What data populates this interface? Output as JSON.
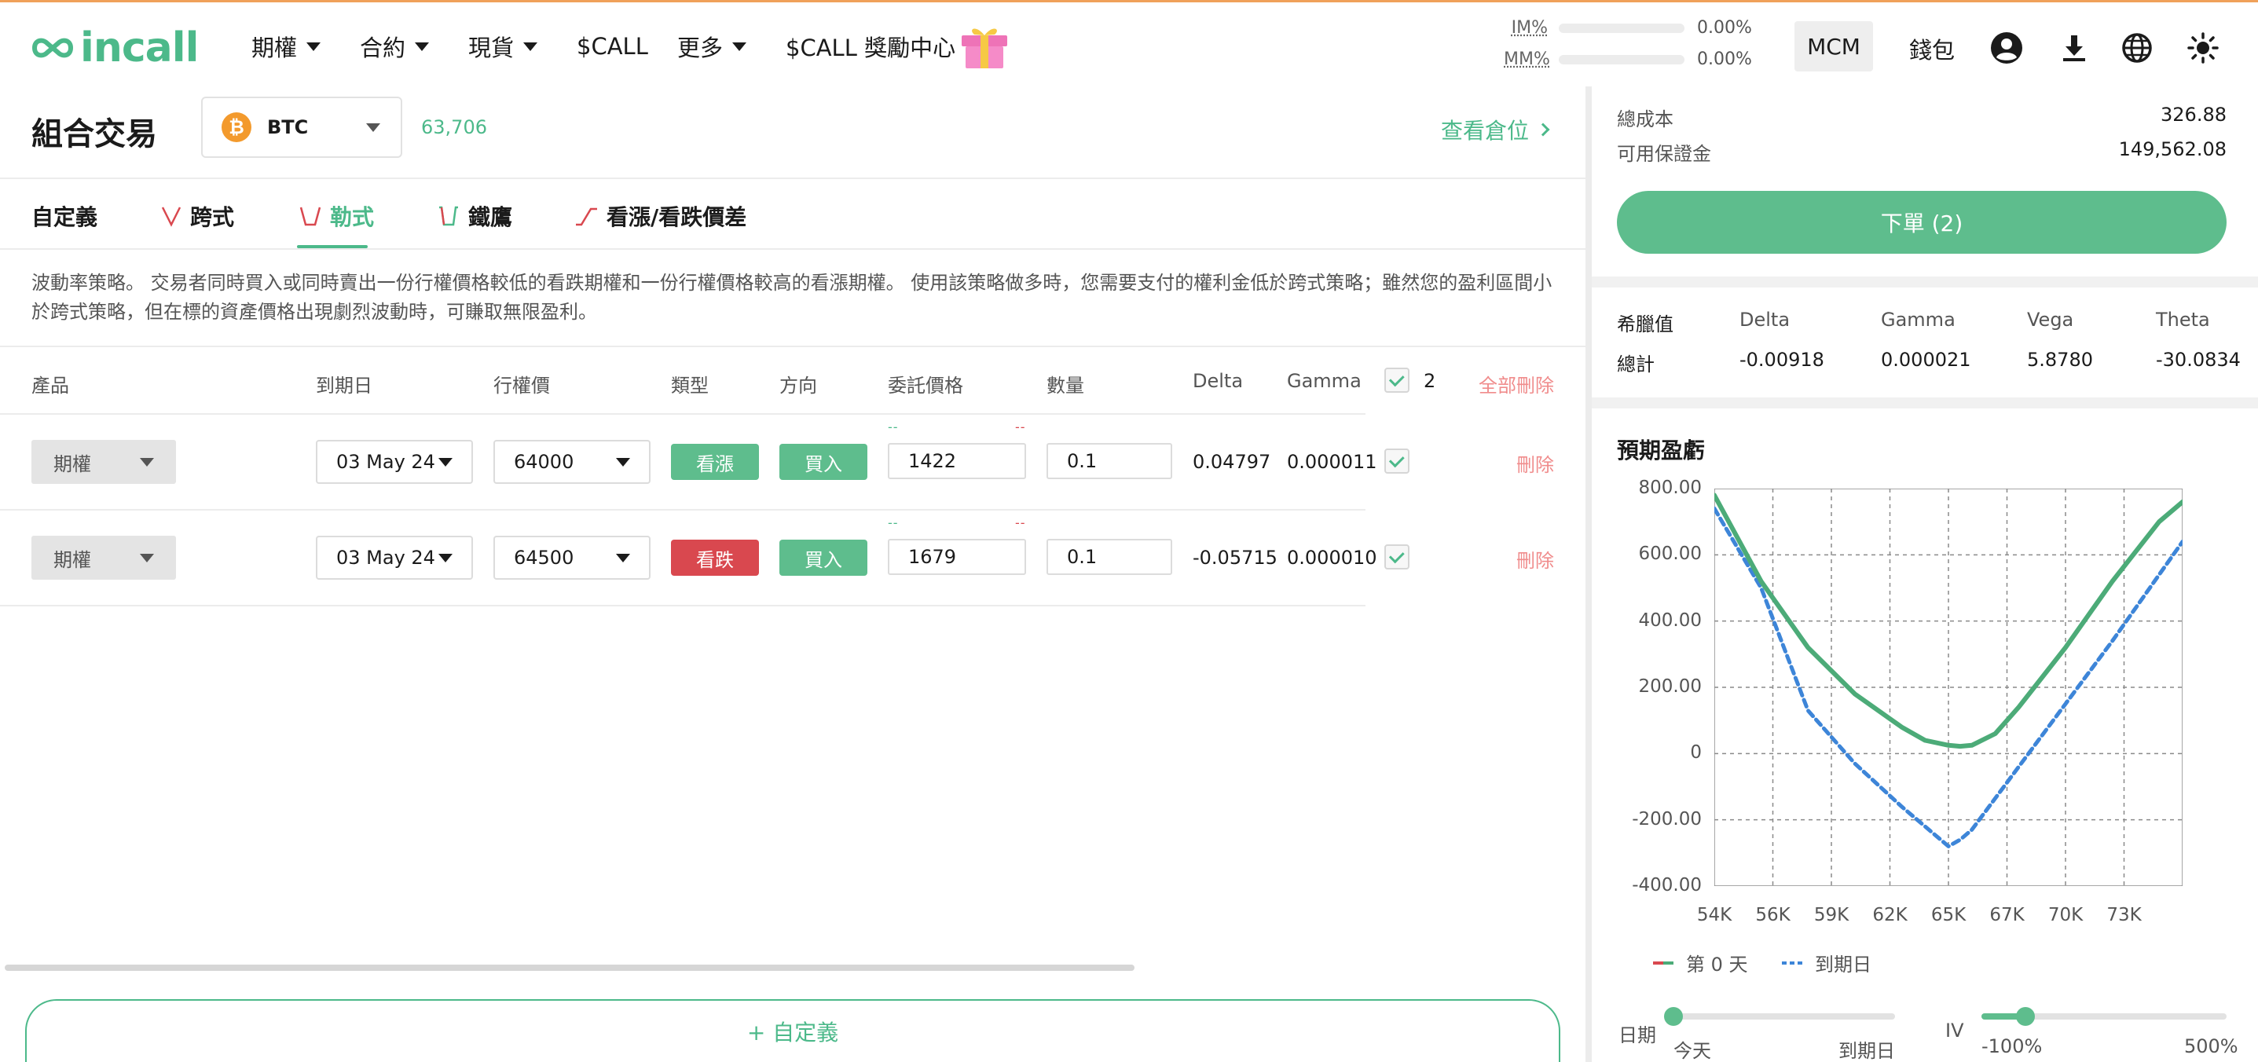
{
  "brand": {
    "name": "incall",
    "accent": "#4cb98a",
    "danger": "#d9484f"
  },
  "nav": {
    "items": [
      {
        "label": "期權",
        "caret": true
      },
      {
        "label": "合約",
        "caret": true
      },
      {
        "label": "現貨",
        "caret": true
      },
      {
        "label": "$CALL",
        "caret": false
      },
      {
        "label": "更多",
        "caret": true
      },
      {
        "label": "$CALL 獎勵中心",
        "caret": false
      }
    ],
    "im_label": "IM%",
    "im_value": "0.00%",
    "mm_label": "MM%",
    "mm_value": "0.00%",
    "mcm_label": "MCM",
    "wallet_label": "錢包",
    "icons": [
      "gift-icon",
      "user-icon",
      "download-icon",
      "globe-icon",
      "sun-icon"
    ]
  },
  "header": {
    "title": "組合交易",
    "asset": "BTC",
    "asset_icon": "bitcoin-icon",
    "price": "63,706",
    "view_positions": "查看倉位"
  },
  "tabs": [
    {
      "label": "自定義",
      "active": false
    },
    {
      "label": "跨式",
      "active": false
    },
    {
      "label": "勒式",
      "active": true
    },
    {
      "label": "鐵鷹",
      "active": false
    },
    {
      "label": "看漲/看跌價差",
      "active": false
    }
  ],
  "description": "波動率策略。 交易者同時買入或同時賣出一份行權價格較低的看跌期權和一份行權價格較高的看漲期權。 使用該策略做多時，您需要支付的權利金低於跨式策略；雖然您的盈利區間小於跨式策略，但在標的資產價格出現劇烈波動時，可賺取無限盈利。",
  "table": {
    "headers": {
      "product": "產品",
      "expiry": "到期日",
      "strike": "行權價",
      "type": "類型",
      "side": "方向",
      "price": "委託價格",
      "qty": "數量",
      "delta": "Delta",
      "gamma": "Gamma"
    },
    "selected_count": "2",
    "delete_all": "全部刪除",
    "rows": [
      {
        "product": "期權",
        "expiry": "03 May 24",
        "strike": "64000",
        "type": "看漲",
        "type_color": "#5ebd8d",
        "side": "買入",
        "bid_hint": "--",
        "ask_hint": "--",
        "price": "1422",
        "qty": "0.1",
        "delta": "0.04797",
        "gamma": "0.000011",
        "delete": "刪除"
      },
      {
        "product": "期權",
        "expiry": "03 May 24",
        "strike": "64500",
        "type": "看跌",
        "type_color": "#d9484f",
        "side": "買入",
        "bid_hint": "--",
        "ask_hint": "--",
        "price": "1679",
        "qty": "0.1",
        "delta": "-0.05715",
        "gamma": "0.000010",
        "delete": "刪除"
      }
    ]
  },
  "add_custom": "+ 自定義",
  "summary": {
    "total_cost_label": "總成本",
    "total_cost": "326.88",
    "margin_label": "可用保證金",
    "margin": "149,562.08",
    "order_button": "下單 (2)"
  },
  "greeks": {
    "header": "希臘值",
    "total_label": "總計",
    "cols": [
      "Delta",
      "Gamma",
      "Vega",
      "Theta"
    ],
    "values": [
      "-0.00918",
      "0.000021",
      "5.8780",
      "-30.0834"
    ]
  },
  "pnl": {
    "title": "預期盈虧",
    "legend": [
      {
        "label": "第 0 天",
        "color": "#4cab78"
      },
      {
        "label": "到期日",
        "color": "#3d85d8"
      }
    ],
    "date_slider": {
      "label": "日期",
      "min_label": "今天",
      "max_label": "到期日",
      "value": 0
    },
    "iv_slider": {
      "label": "IV",
      "min_label": "-100%",
      "max_label": "500%",
      "value": 0.18
    }
  },
  "chart_data": {
    "type": "line",
    "title": "預期盈虧",
    "x_ticks": [
      "54K",
      "56K",
      "59K",
      "62K",
      "65K",
      "67K",
      "70K",
      "73K"
    ],
    "y_ticks": [
      "800.00",
      "600.00",
      "400.00",
      "200.00",
      "0",
      "-200.00",
      "-400.00"
    ],
    "xlim": [
      54000,
      74000
    ],
    "ylim": [
      -400,
      800
    ],
    "grid": true,
    "legend": "bottom",
    "series": [
      {
        "name": "第 0 天",
        "x": [
          54000,
          56000,
          58000,
          60000,
          62000,
          63000,
          64000,
          64500,
          65000,
          66000,
          67000,
          69000,
          71000,
          73000,
          74000
        ],
        "y": [
          780,
          520,
          320,
          180,
          80,
          40,
          25,
          22,
          25,
          60,
          140,
          320,
          520,
          700,
          760
        ]
      },
      {
        "name": "到期日",
        "x": [
          54000,
          56000,
          58000,
          60000,
          62000,
          64000,
          64500,
          65000,
          67000,
          69000,
          71000,
          73000,
          74000
        ],
        "y": [
          740,
          500,
          130,
          -30,
          -160,
          -280,
          -260,
          -230,
          -40,
          150,
          340,
          540,
          640
        ]
      }
    ]
  }
}
